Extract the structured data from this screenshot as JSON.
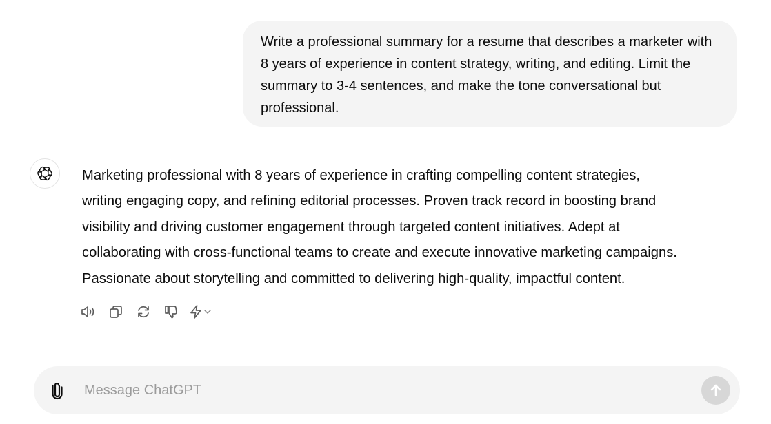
{
  "conversation": {
    "user_message": "Write a professional summary for a resume that describes a marketer with 8 years of experience in content strategy, writing, and editing. Limit the summary to 3-4 sentences, and make the tone conversational but professional.",
    "assistant_message": "Marketing professional with 8 years of experience in crafting compelling content strategies,\nwriting engaging copy, and refining editorial processes. Proven track record in boosting brand\nvisibility and driving customer engagement through targeted content initiatives. Adept at\ncollaborating with cross-functional teams to create and execute innovative marketing campaigns.\nPassionate about storytelling and committed to delivering high-quality, impactful content."
  },
  "action_bar": {
    "icons": [
      "read-aloud-icon",
      "copy-icon",
      "regenerate-icon",
      "thumbs-down-icon",
      "lightning-icon",
      "chevron-down-icon"
    ]
  },
  "composer": {
    "placeholder": "Message ChatGPT",
    "value": "",
    "icons": [
      "paperclip-icon",
      "arrow-up-icon"
    ]
  },
  "colors": {
    "user_bubble_bg": "#f4f4f4",
    "composer_bg": "#f4f4f4",
    "send_button_bg": "#d7d7d7",
    "text": "#0d0d0d",
    "placeholder": "#9b9b9b"
  }
}
